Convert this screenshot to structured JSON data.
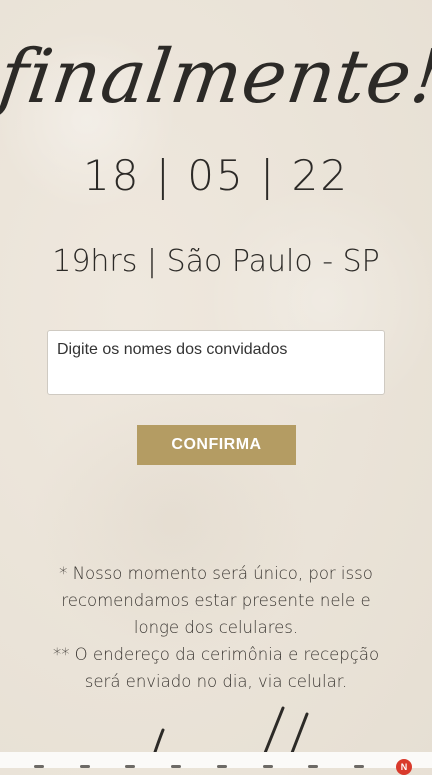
{
  "title": "finalmente!",
  "date": "18 | 05 | 22",
  "place": "19hrs | São Paulo - SP",
  "form": {
    "guest_placeholder": "Digite os nomes dos convidados",
    "confirm_label": "CONFIRMA"
  },
  "notes": {
    "note1": "* Nosso momento será único, por isso recomendamos estar presente nele e longe dos celulares.",
    "note2": "** O endereço da cerimônia e recepção será enviado no dia, via celular."
  },
  "notification_badge": "N",
  "colors": {
    "background": "#ebe4d9",
    "text": "#2c2a27",
    "button": "#b49c63",
    "badge": "#d93a2c"
  }
}
